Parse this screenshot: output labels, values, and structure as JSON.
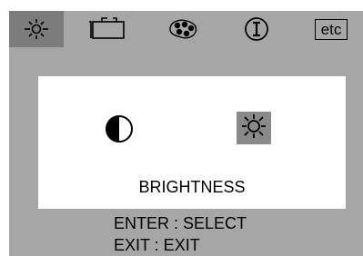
{
  "tabs": [
    {
      "id": "brightness-contrast",
      "icon": "sun-icon",
      "active": true
    },
    {
      "id": "geometry",
      "icon": "screen-position-icon",
      "active": false
    },
    {
      "id": "color",
      "icon": "color-palette-icon",
      "active": false
    },
    {
      "id": "information",
      "icon": "info-icon",
      "active": false
    },
    {
      "id": "etc",
      "label": "etc",
      "active": false
    }
  ],
  "content": {
    "options": [
      {
        "icon": "contrast-icon",
        "selected": false
      },
      {
        "icon": "sun-icon",
        "selected": true
      }
    ],
    "title": "BRIGHTNESS"
  },
  "hints": {
    "enter": "ENTER : SELECT",
    "exit": "EXIT : EXIT"
  },
  "colors": {
    "panel": "#a6a6a6",
    "active_tab": "#7c7c7c",
    "selected_option": "#8a8a8a",
    "content": "#ffffff",
    "text": "#000000"
  }
}
